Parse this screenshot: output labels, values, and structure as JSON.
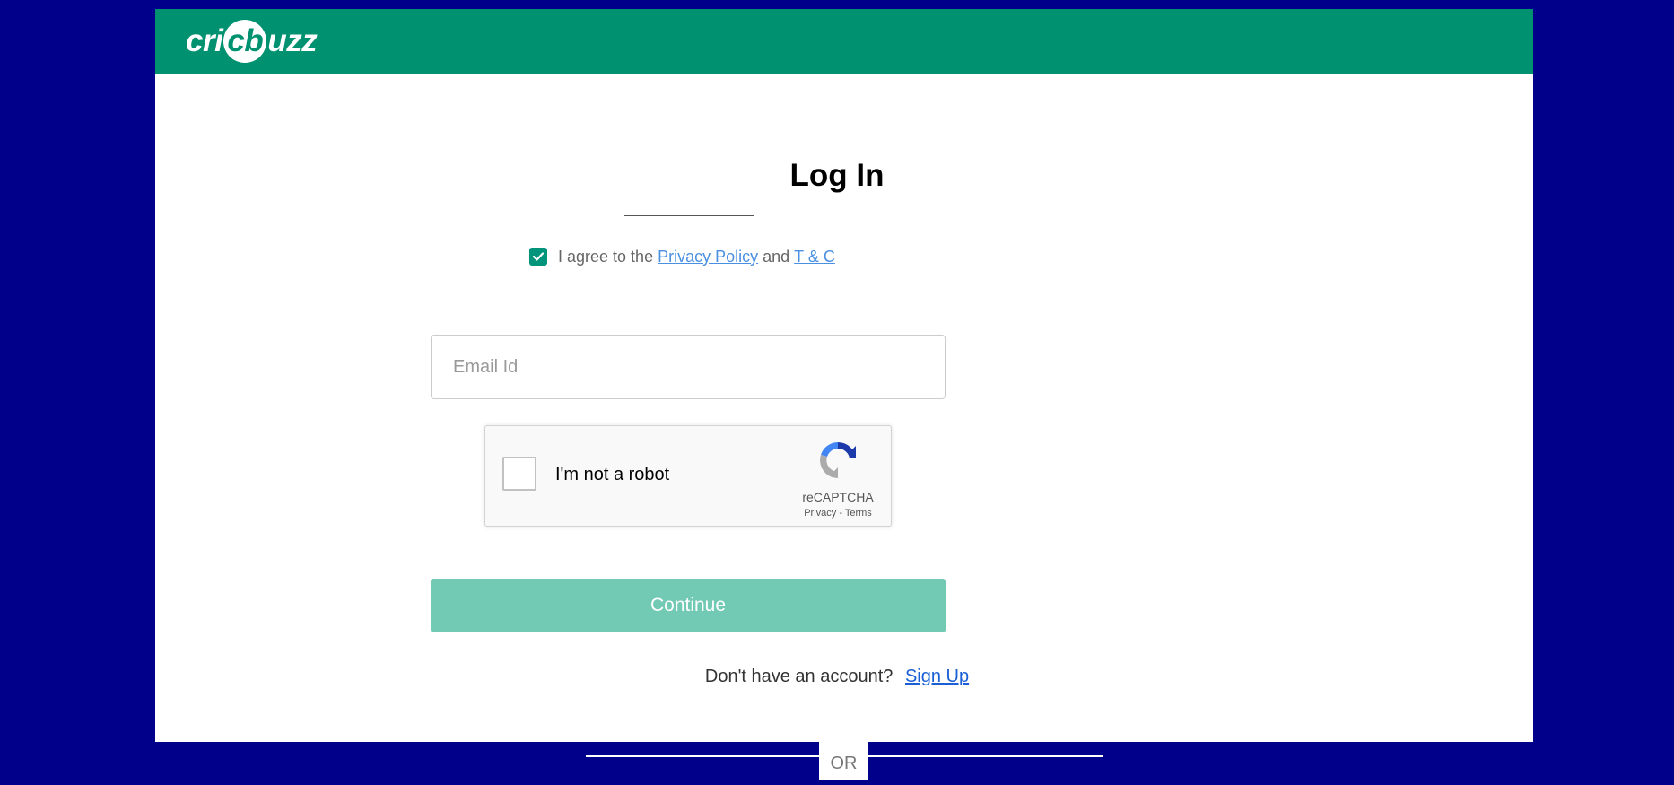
{
  "header": {
    "logo_text_left": "cri",
    "logo_text_ball": "cb",
    "logo_text_right": "uzz",
    "brand_color": "#009270"
  },
  "page_title": "Log In",
  "agree": {
    "checked": true,
    "prefix": "I agree to the",
    "privacy_link": "Privacy Policy",
    "conjunction": "and",
    "tc_link": "T & C"
  },
  "email": {
    "placeholder": "Email Id",
    "value": ""
  },
  "captcha": {
    "label": "I'm not a robot",
    "brand": "reCAPTCHA",
    "privacy": "Privacy",
    "separator": "-",
    "terms": "Terms"
  },
  "continue_label": "Continue",
  "signup": {
    "prompt": "Don't have an account?",
    "link": "Sign Up"
  },
  "divider_text": "OR",
  "colors": {
    "background": "#00008b",
    "accent": "#009270",
    "button": "#72cab5",
    "link": "#4a90e2"
  }
}
